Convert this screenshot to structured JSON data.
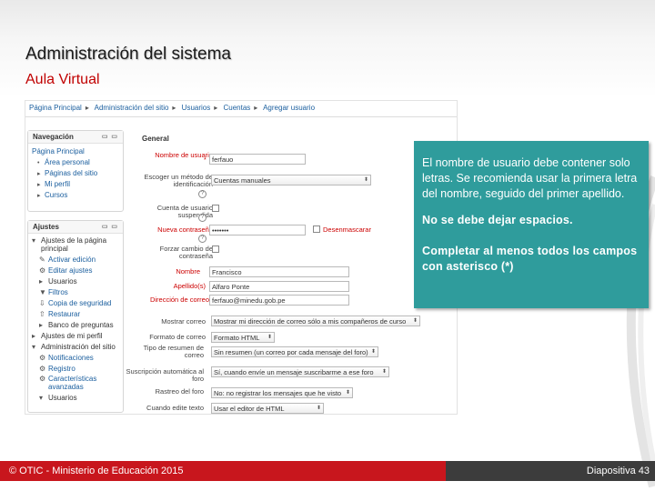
{
  "slide": {
    "title": "Administración del sistema",
    "subtitle": "Aula Virtual"
  },
  "breadcrumb": [
    "Página Principal",
    "Administración del sitio",
    "Usuarios",
    "Cuentas",
    "Agregar usuario"
  ],
  "navigation": {
    "title": "Navegación",
    "items": [
      {
        "label": "Página Principal",
        "bullet": ""
      },
      {
        "label": "Área personal",
        "bullet": "•"
      },
      {
        "label": "Páginas del sitio",
        "bullet": "▸"
      },
      {
        "label": "Mi perfil",
        "bullet": "▸"
      },
      {
        "label": "Cursos",
        "bullet": "▸"
      }
    ]
  },
  "settings": {
    "title": "Ajustes",
    "items": [
      {
        "label": "Ajustes de la página",
        "label2": "principal",
        "icon": "▾",
        "icon_name": "expand-icon",
        "link": false
      },
      {
        "label": "Activar edición",
        "icon": "✎",
        "icon_name": "pencil-icon",
        "link": true
      },
      {
        "label": "Editar ajustes",
        "icon": "⚙",
        "icon_name": "gear-icon",
        "link": true
      },
      {
        "label": "Usuarios",
        "icon": "▸",
        "icon_name": "expand-icon",
        "link": false
      },
      {
        "label": "Filtros",
        "icon": "▼",
        "icon_name": "filter-icon",
        "link": true
      },
      {
        "label": "Copia de seguridad",
        "icon": "⇩",
        "icon_name": "backup-icon",
        "link": true
      },
      {
        "label": "Restaurar",
        "icon": "⇧",
        "icon_name": "restore-icon",
        "link": true
      },
      {
        "label": "Banco de preguntas",
        "icon": "▸",
        "icon_name": "expand-icon",
        "link": false
      },
      {
        "label": "Ajustes de mi perfil",
        "icon": "▸",
        "icon_name": "expand-icon",
        "link": false
      },
      {
        "label": "Administración del sitio",
        "icon": "▾",
        "icon_name": "expand-icon",
        "link": false
      },
      {
        "label": "Notificaciones",
        "icon": "⚙",
        "icon_name": "gear-icon",
        "link": true
      },
      {
        "label": "Registro",
        "icon": "⚙",
        "icon_name": "gear-icon",
        "link": true
      },
      {
        "label": "Características",
        "label2": "avanzadas",
        "icon": "⚙",
        "icon_name": "gear-icon",
        "link": true
      },
      {
        "label": "Usuarios",
        "icon": "▾",
        "icon_name": "expand-icon",
        "link": false
      }
    ]
  },
  "form": {
    "section": "General",
    "username_label": "Nombre de usuario",
    "username_value": "ferfauo",
    "auth_label": "Escoger un método de identificación",
    "auth_value": "Cuentas manuales",
    "suspended_label": "Cuenta de usuario suspendida",
    "password_label": "Nueva contraseña",
    "password_value": "•••••••",
    "unmask_label": "Desenmascarar",
    "force_change_label": "Forzar cambio de contraseña",
    "firstname_label": "Nombre",
    "firstname_value": "Francisco",
    "lastname_label": "Apellido(s)",
    "lastname_value": "Alfaro Ponte",
    "email_label": "Dirección de correo",
    "email_value": "ferfauo@minedu.gob.pe",
    "show_email_label": "Mostrar correo",
    "show_email_value": "Mostrar mi dirección de correo sólo a mis compañeros de curso",
    "email_format_label": "Formato de correo",
    "email_format_value": "Formato HTML",
    "digest_label": "Tipo de resumen de correo",
    "digest_value": "Sin resumen (un correo por cada mensaje del foro)",
    "autosub_label": "Suscripción automática al foro",
    "autosub_value": "Sí, cuando envíe un mensaje suscribarme a ese foro",
    "tracking_label": "Rastreo del foro",
    "tracking_value": "No: no registrar los mensajes que he visto",
    "editor_label": "Cuando edite texto",
    "editor_value": "Usar el editor de HTML"
  },
  "info": {
    "p1": "El nombre de usuario debe contener solo letras. Se recomienda usar la primera letra del nombre, seguido del primer apellido.",
    "p2": "No se debe dejar espacios.",
    "p3": "Completar al menos todos los campos con asterisco (*)"
  },
  "footer": {
    "left": "© OTIC - Ministerio de Educación 2015",
    "right": "Diapositiva 43"
  },
  "colors": {
    "info_bg": "#2f9c9c",
    "footer_red": "#c8161d",
    "footer_dark": "#3c3c3c",
    "subtitle_red": "#c00000",
    "link_blue": "#1a5e9e"
  }
}
